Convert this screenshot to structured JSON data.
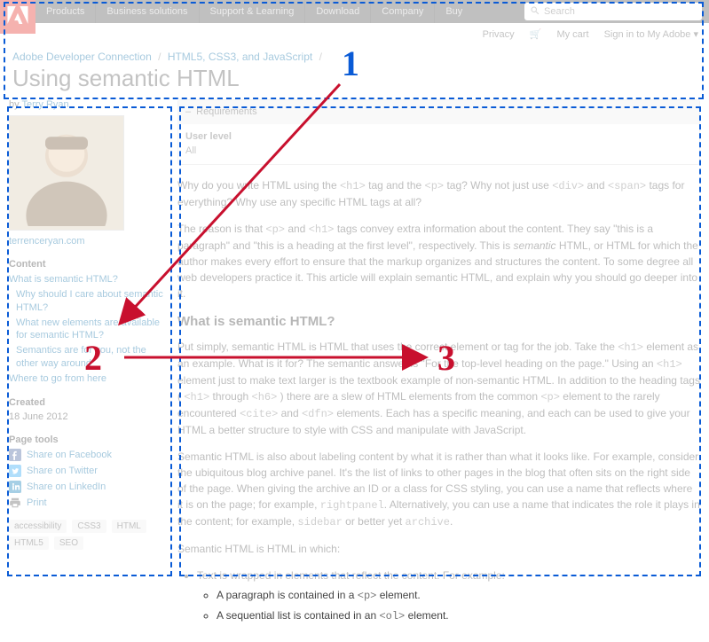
{
  "nav": {
    "items": [
      "Products",
      "Business solutions",
      "Support & Learning",
      "Download",
      "Company",
      "Buy"
    ]
  },
  "search": {
    "placeholder": "Search"
  },
  "userbar": {
    "privacy": "Privacy",
    "cart": "My cart",
    "signin": "Sign in to My Adobe ▾"
  },
  "breadcrumb": {
    "a": "Adobe Developer Connection",
    "b": "HTML5, CSS3, and JavaScript"
  },
  "title": "Using semantic HTML",
  "byline": {
    "prefix": "by ",
    "author": "Terry Ryan"
  },
  "author_site": "terrenceryan.com",
  "content_head": "Content",
  "toc": [
    "What is semantic HTML?",
    "Why should I care about semantic HTML?",
    "What new elements are available for semantic HTML?",
    "Semantics are for you, not the other way around",
    "Where to go from here"
  ],
  "created_head": "Created",
  "created_val": "18 June 2012",
  "tools_head": "Page tools",
  "tool_fb": "Share on Facebook",
  "tool_tw": "Share on Twitter",
  "tool_li": "Share on LinkedIn",
  "tool_pr": "Print",
  "tags": [
    "accessibility",
    "CSS3",
    "HTML",
    "HTML5",
    "SEO"
  ],
  "req": {
    "title": "Requirements",
    "label": "User level",
    "value": "All"
  },
  "article": {
    "p1a": "Why do you write HTML using the ",
    "p1b": " tag and the ",
    "p1c": " tag? Why not just use ",
    "p1d": " and ",
    "p1e": " tags for everything? Why use any specific HTML tags at all?",
    "p2a": "The reason is that ",
    "p2b": " and ",
    "p2c": " tags convey extra information about the content. They say \"this is a paragraph\" and \"this is a heading at the first level\", respectively. This is ",
    "p2d": "semantic",
    "p2e": " HTML, or HTML for which the author makes every effort to ensure that the markup organizes and structures the content. To some degree all web developers practice it. This article will explain semantic HTML, and explain why you should go deeper into it.",
    "h2a": "What is semantic HTML?",
    "p3a": "Put simply, semantic HTML is HTML that uses the correct element or tag for the job. Take the ",
    "p3b": " element as an example. What is it for? The semantic answer is \"For the top-level heading on the page.\" Using an ",
    "p3c": " element just to make text larger is the textbook example of non-semantic HTML. In addition to the heading tags ( ",
    "p3d": " through ",
    "p3e": " ) there are a slew of HTML elements from the common ",
    "p3f": " element to the rarely encountered ",
    "p3g": " and ",
    "p3h": " elements. Each has a specific meaning, and each can be used to give your HTML a better structure to style with CSS and manipulate with JavaScript.",
    "p4a": "Semantic HTML is also about labeling content by what it is rather than what it looks like. For example, consider the ubiquitous blog archive panel. It's the list of links to other pages in the blog that often sits on the right side of the page. When giving the archive an ID or a class for CSS styling, you can use a name that reflects where it is on the page; for example, ",
    "p4b": ". Alternatively, you can use a name that indicates the role it plays in the content; for example, ",
    "p4c": " or better yet ",
    "p4d": ".",
    "p5": "Semantic HTML is HTML in which:",
    "li1": "Text is wrapped in elements that reflect the content. For example:",
    "li1a_a": "A paragraph is contained in a ",
    "li1a_b": " element.",
    "li1b_a": "A sequential list is contained in an ",
    "li1b_b": " element.",
    "code": {
      "h1": "<h1>",
      "p": "<p>",
      "div": "<div>",
      "span": "<span>",
      "h6": "<h6>",
      "cite": "<cite>",
      "dfn": "<dfn>",
      "rightpanel": "rightpanel",
      "sidebar": "sidebar",
      "archive": "archive",
      "ol": "<ol>"
    }
  },
  "anno": {
    "n1": "1",
    "n2": "2",
    "n3": "3"
  }
}
